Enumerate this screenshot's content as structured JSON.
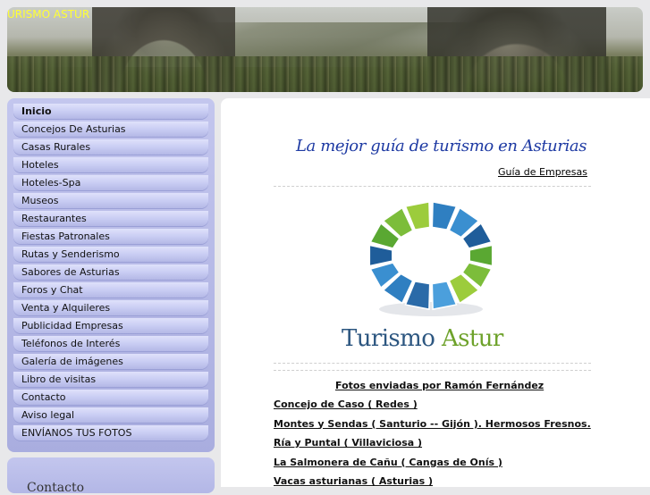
{
  "header": {
    "title": "URISMO ASTUR"
  },
  "sidebar": {
    "items": [
      {
        "label": "Inicio",
        "active": true
      },
      {
        "label": "Concejos De Asturias"
      },
      {
        "label": "Casas Rurales"
      },
      {
        "label": "Hoteles"
      },
      {
        "label": "Hoteles-Spa"
      },
      {
        "label": "Museos"
      },
      {
        "label": "Restaurantes"
      },
      {
        "label": "Fiestas Patronales"
      },
      {
        "label": "Rutas y Senderismo"
      },
      {
        "label": "Sabores de Asturias"
      },
      {
        "label": "Foros y Chat"
      },
      {
        "label": "Venta y Alquileres"
      },
      {
        "label": "Publicidad Empresas"
      },
      {
        "label": "Teléfonos de Interés"
      },
      {
        "label": "Galería de imágenes"
      },
      {
        "label": "Libro de visitas"
      },
      {
        "label": "Contacto"
      },
      {
        "label": "Aviso legal"
      },
      {
        "label": "ENVÍANOS TUS FOTOS"
      }
    ],
    "accent_color": "#b3b7e6"
  },
  "sidebar2": {
    "title": "Contacto"
  },
  "main": {
    "tagline": "La mejor guía de turismo en Asturias",
    "guia_link": "Guía de Empresas",
    "logo": {
      "word1": "Turismo",
      "word2": "Astur",
      "colors": {
        "blue": "#2c5680",
        "green": "#6ea22b"
      }
    },
    "fotos_heading": "Fotos enviadas por Ramón Fernández",
    "photo_links": [
      "Concejo de Caso ( Redes )",
      "Montes y Sendas ( Santurio -- Gijón ). Hermosos Fresnos.",
      "Ría y Puntal ( Villaviciosa )",
      "La Salmonera de Cañu ( Cangas de Onís )",
      "Vacas asturianas ( Asturias )"
    ]
  }
}
